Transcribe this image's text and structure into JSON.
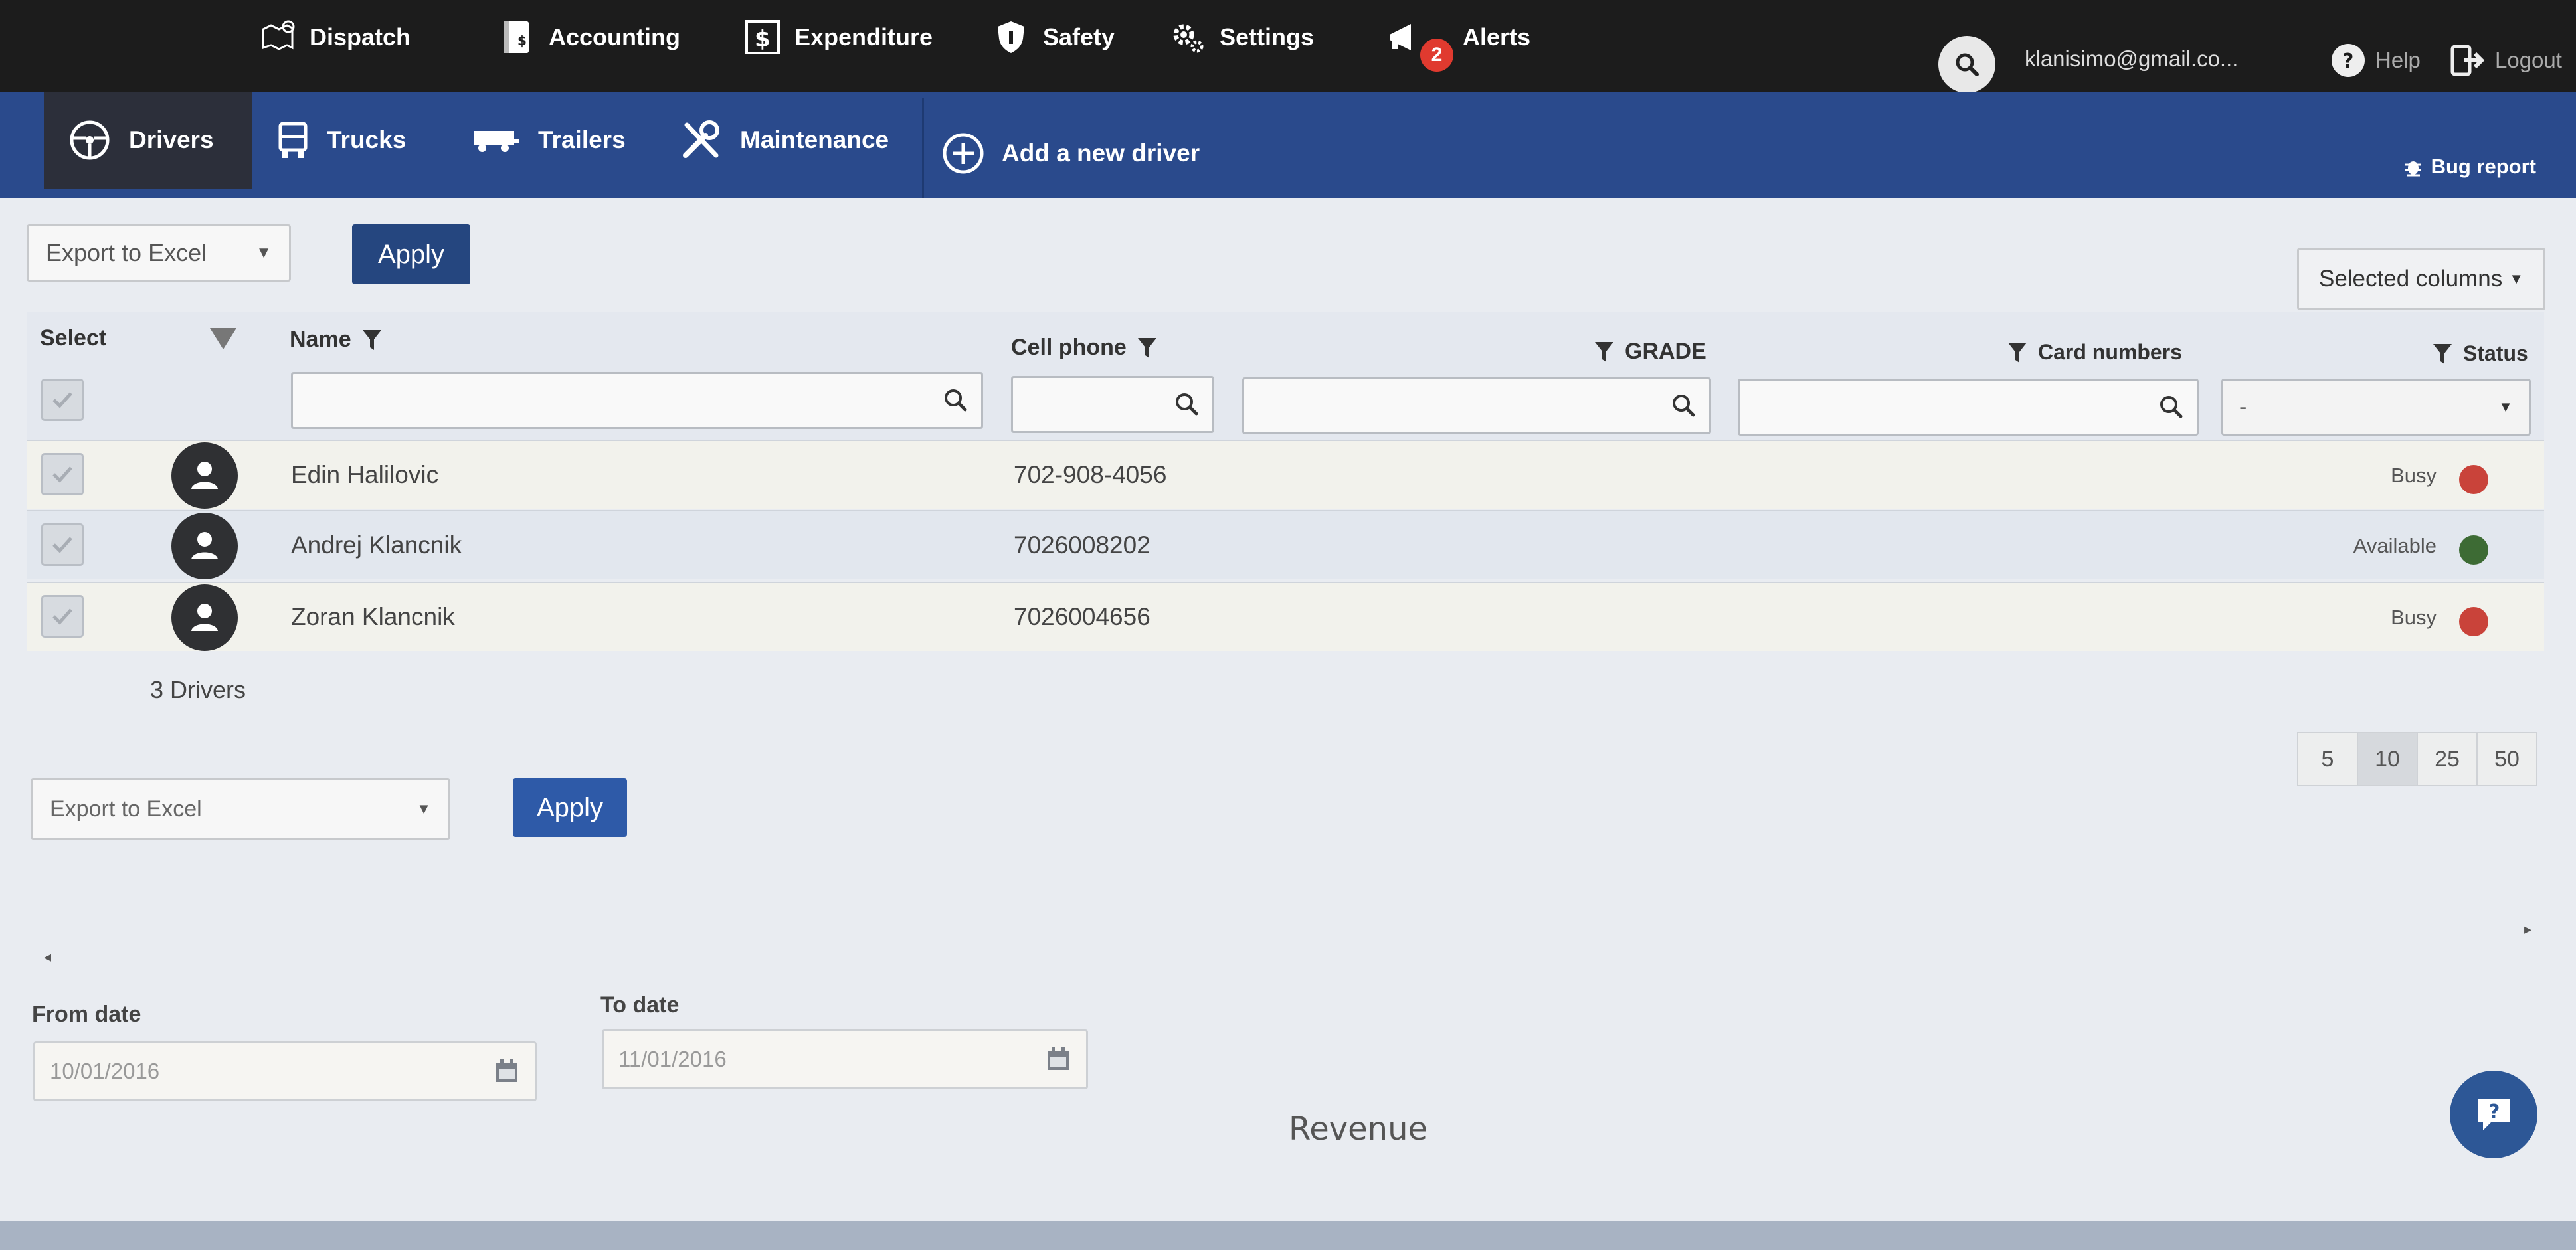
{
  "top_nav": {
    "items": [
      {
        "label": "Dispatch",
        "icon": "map-icon"
      },
      {
        "label": "Accounting",
        "icon": "ledger-icon"
      },
      {
        "label": "Expenditure",
        "icon": "dollar-icon"
      },
      {
        "label": "Safety",
        "icon": "shield-icon"
      },
      {
        "label": "Settings",
        "icon": "gear-icon"
      },
      {
        "label": "Alerts",
        "icon": "megaphone-icon"
      }
    ],
    "alerts_count": "2",
    "user_email": "klanisimo@gmail.co...",
    "help_label": "Help",
    "logout_label": "Logout"
  },
  "sub_nav": {
    "tabs": [
      {
        "label": "Drivers",
        "icon": "steering-wheel-icon",
        "active": true
      },
      {
        "label": "Trucks",
        "icon": "truck-icon"
      },
      {
        "label": "Trailers",
        "icon": "trailer-icon"
      },
      {
        "label": "Maintenance",
        "icon": "tools-icon"
      }
    ],
    "add_label": "Add a new driver",
    "bug_report_label": "Bug report"
  },
  "toolbar": {
    "export_value": "Export to Excel",
    "apply_label": "Apply",
    "selected_columns_label": "Selected columns"
  },
  "grid": {
    "columns": {
      "select": "Select",
      "name": "Name",
      "cell_phone": "Cell phone",
      "grade": "GRADE",
      "card_numbers": "Card numbers",
      "status": "Status"
    },
    "status_filter_value": "-",
    "rows": [
      {
        "name": "Edin Halilovic",
        "phone": "702-908-4056",
        "status": "Busy",
        "status_color": "#c9433a"
      },
      {
        "name": "Andrej Klancnik",
        "phone": "7026008202",
        "status": "Available",
        "status_color": "#3d6b34"
      },
      {
        "name": "Zoran Klancnik",
        "phone": "7026004656",
        "status": "Busy",
        "status_color": "#c9433a"
      }
    ],
    "count_label": "3 Drivers"
  },
  "pager": {
    "sizes": [
      "5",
      "10",
      "25",
      "50"
    ],
    "active": "10"
  },
  "bottom_toolbar": {
    "export_value": "Export to Excel",
    "apply_label": "Apply"
  },
  "dates": {
    "from_label": "From date",
    "from_value": "10/01/2016",
    "to_label": "To date",
    "to_value": "11/01/2016"
  },
  "revenue_title": "Revenue",
  "colors": {
    "topbar": "#1c1c1c",
    "subnav": "#2a4a8c",
    "accent": "#2e5aa8",
    "busy": "#c9433a",
    "available": "#3d6b34"
  }
}
